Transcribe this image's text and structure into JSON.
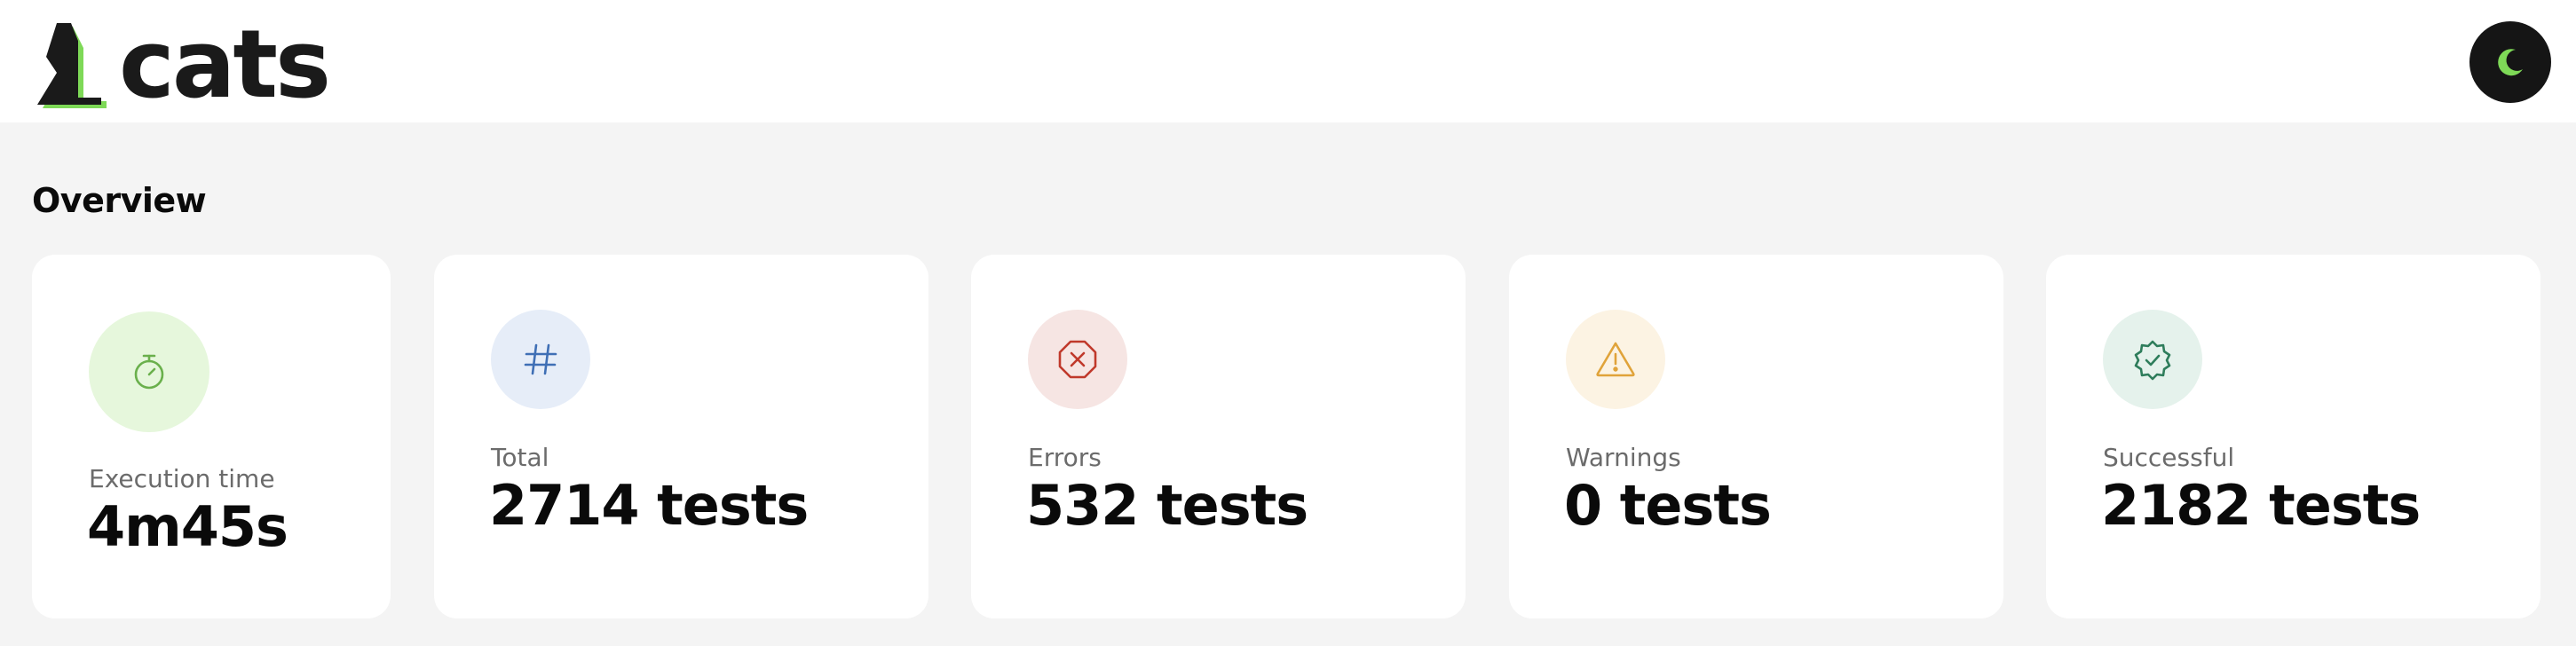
{
  "app": {
    "logo_text": "cats",
    "logo_icon": "cats-logo-icon",
    "theme_toggle_icon": "moon-icon",
    "accent_color": "#7ed957"
  },
  "overview": {
    "title": "Overview",
    "cards": [
      {
        "label": "Execution time",
        "value": "4m45s",
        "icon": "stopwatch-icon",
        "icon_color": "#6ab04c",
        "icon_bg": "#e6f7dc"
      },
      {
        "label": "Total",
        "value": "2714 tests",
        "icon": "hash-icon",
        "icon_color": "#3f6fb5",
        "icon_bg": "#e6edf8"
      },
      {
        "label": "Errors",
        "value": "532 tests",
        "icon": "error-octagon-icon",
        "icon_color": "#c0392b",
        "icon_bg": "#f6e5e3"
      },
      {
        "label": "Warnings",
        "value": "0 tests",
        "icon": "warning-triangle-icon",
        "icon_color": "#e0a33a",
        "icon_bg": "#fcf3e3"
      },
      {
        "label": "Successful",
        "value": "2182 tests",
        "icon": "verified-badge-icon",
        "icon_color": "#2e7d5b",
        "icon_bg": "#e5f2ec"
      }
    ]
  }
}
